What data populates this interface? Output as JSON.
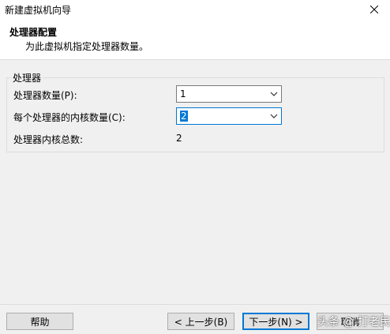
{
  "window": {
    "title": "新建虚拟机向导"
  },
  "header": {
    "title": "处理器配置",
    "subtitle": "为此虚拟机指定处理器数量。"
  },
  "group": {
    "title": "处理器",
    "processor_count_label": "处理器数量(P):",
    "processor_count_value": "1",
    "cores_per_processor_label": "每个处理器的内核数量(C):",
    "cores_per_processor_value": "2",
    "total_cores_label": "处理器内核总数:",
    "total_cores_value": "2"
  },
  "buttons": {
    "help": "帮助",
    "back": "< 上一步(B)",
    "next": "下一步(N) >",
    "cancel": "取消"
  },
  "watermark": "头条 @ 打老民",
  "colors": {
    "accent": "#0078d7",
    "background": "#f0f0f0"
  },
  "icons": {
    "close": "close-icon",
    "dropdown": "chevron-down-icon"
  }
}
